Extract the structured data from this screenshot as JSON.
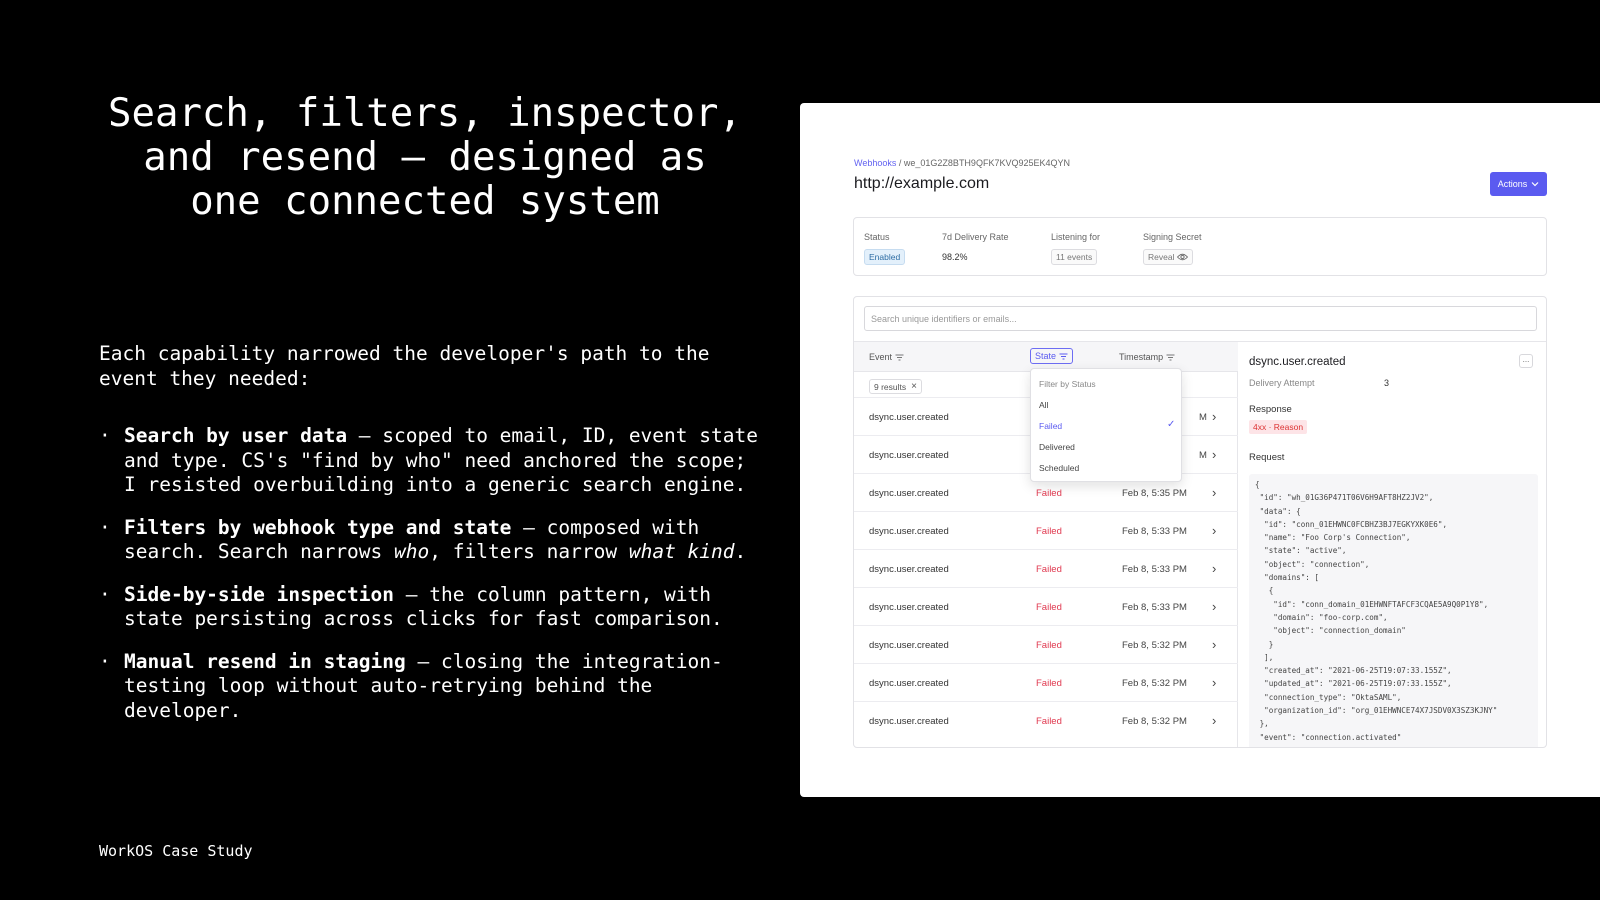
{
  "slide": {
    "title": "Search, filters, inspector, and resend — designed as one connected system",
    "intro": "Each capability narrowed the developer's path to the event they needed:",
    "bullets": [
      {
        "bold": "Search by user data",
        "rest": " — scoped to email, ID, event state and type. CS's \"find by who\" need anchored the scope; I resisted overbuilding into a generic search engine."
      },
      {
        "bold": "Filters by webhook type and state",
        "rest_a": " — composed with search. Search narrows ",
        "italic_a": "who",
        "rest_b": ", filters narrow ",
        "italic_b": "what kind",
        "rest_c": "."
      },
      {
        "bold": "Side-by-side inspection",
        "rest": " — the column pattern, with state persisting across clicks for fast comparison."
      },
      {
        "bold": "Manual resend in staging",
        "rest": " — closing the integration-testing loop without auto-retrying behind the developer."
      }
    ],
    "bullet_marker": "·",
    "footer": "WorkOS Case Study"
  },
  "app": {
    "breadcrumb": {
      "link": "Webhooks",
      "separator": "/",
      "id": "we_01G2Z8BTH9QFK7KVQ925EK4QYN"
    },
    "page_title": "http://example.com",
    "actions_label": "Actions",
    "stats": [
      {
        "label": "Status",
        "value": "Enabled"
      },
      {
        "label": "7d Delivery Rate",
        "value": "98.2%"
      },
      {
        "label": "Listening for",
        "value": "11 events"
      },
      {
        "label": "Signing Secret",
        "value": "Reveal"
      }
    ],
    "search_placeholder": "Search unique identifiers or emails...",
    "columns": {
      "event": "Event",
      "state": "State",
      "timestamp": "Timestamp"
    },
    "results_badge": "9 results",
    "rows": [
      {
        "event": "dsync.user.created",
        "state": "",
        "timestamp": "M"
      },
      {
        "event": "dsync.user.created",
        "state": "",
        "timestamp": "M"
      },
      {
        "event": "dsync.user.created",
        "state": "Failed",
        "timestamp": "Feb 8, 5:35 PM"
      },
      {
        "event": "dsync.user.created",
        "state": "Failed",
        "timestamp": "Feb 8, 5:33 PM"
      },
      {
        "event": "dsync.user.created",
        "state": "Failed",
        "timestamp": "Feb 8, 5:33 PM"
      },
      {
        "event": "dsync.user.created",
        "state": "Failed",
        "timestamp": "Feb 8, 5:33 PM"
      },
      {
        "event": "dsync.user.created",
        "state": "Failed",
        "timestamp": "Feb 8, 5:32 PM"
      },
      {
        "event": "dsync.user.created",
        "state": "Failed",
        "timestamp": "Feb 8, 5:32 PM"
      },
      {
        "event": "dsync.user.created",
        "state": "Failed",
        "timestamp": "Feb 8, 5:32 PM"
      }
    ],
    "filter_dropdown": {
      "heading": "Filter by Status",
      "options": [
        "All",
        "Failed",
        "Delivered",
        "Scheduled"
      ],
      "selected": "Failed"
    },
    "inspector": {
      "title": "dsync.user.created",
      "more": "...",
      "delivery_label": "Delivery Attempt",
      "delivery_value": "3",
      "response_label": "Response",
      "response_badge": "4xx · Reason",
      "request_label": "Request",
      "request_body": "{\n \"id\": \"wh_01G36P471T06V6H9AFT8HZ2JV2\",\n \"data\": {\n  \"id\": \"conn_01EHWNC0FCBHZ3BJ7EGKYXK0E6\",\n  \"name\": \"Foo Corp's Connection\",\n  \"state\": \"active\",\n  \"object\": \"connection\",\n  \"domains\": [\n   {\n    \"id\": \"conn_domain_01EHWNFTAFCF3CQAE5A9Q0P1Y8\",\n    \"domain\": \"foo-corp.com\",\n    \"object\": \"connection_domain\"\n   }\n  ],\n  \"created_at\": \"2021-06-25T19:07:33.155Z\",\n  \"updated_at\": \"2021-06-25T19:07:33.155Z\",\n  \"connection_type\": \"OktaSAML\",\n  \"organization_id\": \"org_01EHWNCE74X7JSDV0X3SZ3KJNY\"\n },\n \"event\": \"connection.activated\""
    },
    "colors": {
      "accent": "#5b5bf0",
      "failed": "#e0384f",
      "enabled_bg": "#e3f0fb"
    }
  }
}
